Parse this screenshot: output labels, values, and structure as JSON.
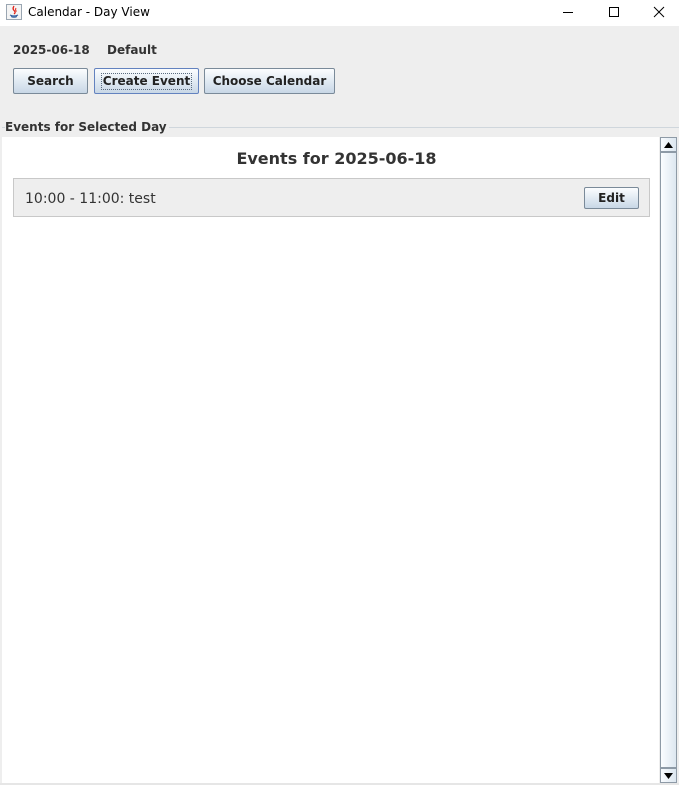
{
  "window": {
    "title": "Calendar - Day View",
    "controls": [
      "minimize-icon",
      "maximize-icon",
      "close-icon"
    ]
  },
  "header": {
    "date": "2025-06-18",
    "calendar_name": "Default"
  },
  "toolbar": {
    "search_label": "Search",
    "create_label": "Create Event",
    "choose_label": "Choose Calendar"
  },
  "panel": {
    "border_title": "Events for Selected Day",
    "heading": "Events for 2025-06-18"
  },
  "events": [
    {
      "text": "10:00 - 11:00: test",
      "edit_label": "Edit"
    }
  ],
  "colors": {
    "window_bg": "#eeeeee",
    "content_bg": "#ffffff",
    "focus_border": "#6382bf"
  }
}
